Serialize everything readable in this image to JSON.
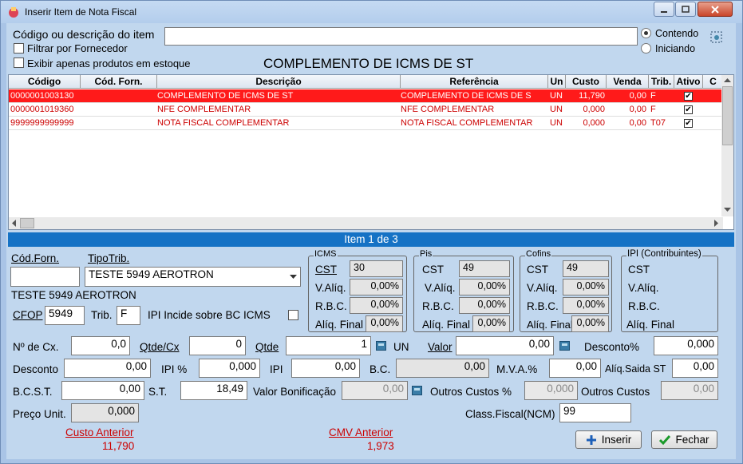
{
  "window": {
    "title": "Inserir Item de Nota Fiscal"
  },
  "search": {
    "label": "Código ou descrição do item",
    "value": "",
    "filter_supplier": "Filtrar por Fornecedor",
    "stock_only": "Exibir apenas produtos em estoque",
    "contendo": "Contendo",
    "iniciando": "Iniciando"
  },
  "selected_title": "COMPLEMENTO DE ICMS DE ST",
  "grid": {
    "headers": [
      "Código",
      "Cód. Forn.",
      "Descrição",
      "Referência",
      "Un",
      "Custo",
      "Venda",
      "Trib.",
      "Ativo",
      "C"
    ],
    "rows": [
      {
        "codigo": "0000001003130",
        "forn": "",
        "descricao": "COMPLEMENTO DE ICMS DE ST",
        "referencia": "COMPLEMENTO DE ICMS DE S",
        "un": "UN",
        "custo": "11,790",
        "venda": "0,00",
        "trib": "F",
        "ativo": "✔"
      },
      {
        "codigo": "0000001019360",
        "forn": "",
        "descricao": "NFE COMPLEMENTAR",
        "referencia": "NFE COMPLEMENTAR",
        "un": "UN",
        "custo": "0,000",
        "venda": "0,00",
        "trib": "F",
        "ativo": "✔"
      },
      {
        "codigo": "9999999999999",
        "forn": "",
        "descricao": "NOTA FISCAL COMPLEMENTAR",
        "referencia": "NOTA FISCAL COMPLEMENTAR",
        "un": "UN",
        "custo": "0,000",
        "venda": "0,00",
        "trib": "T07",
        "ativo": "✔"
      }
    ]
  },
  "item_bar": "Item 1 de 3",
  "form": {
    "cod_forn_label": "Cód.Forn.",
    "cod_forn_value": "",
    "tipotrib_label": "TipoTrib.",
    "tipotrib_value": "TESTE 5949 AEROTRON",
    "tipotrib_desc": "TESTE 5949 AEROTRON",
    "cfop_label": "CFOP",
    "cfop_value": "5949",
    "trib_label": "Trib.",
    "trib_value": "F",
    "ipi_incide_label": "IPI Incide sobre BC ICMS",
    "icms": {
      "title": "ICMS",
      "cst_label": "CST",
      "cst": "30",
      "valiq_label": "V.Alíq.",
      "valiq": "0,00%",
      "rbc_label": "R.B.C.",
      "rbc": "0,00%",
      "aliqfinal_label": "Alíq. Final",
      "aliqfinal": "0,00%"
    },
    "pis": {
      "title": "Pis",
      "cst_label": "CST",
      "cst": "49",
      "valiq_label": "V.Alíq.",
      "valiq": "0,00%",
      "rbc_label": "R.B.C.",
      "rbc": "0,00%",
      "aliqfinal_label": "Alíq. Final",
      "aliqfinal": "0,00%"
    },
    "cofins": {
      "title": "Cofins",
      "cst_label": "CST",
      "cst": "49",
      "valiq_label": "V.Alíq.",
      "valiq": "0,00%",
      "rbc_label": "R.B.C.",
      "rbc": "0,00%",
      "aliqfinal_label": "Alíq. Final",
      "aliqfinal": "0,00%"
    },
    "ipi": {
      "title": "IPI (Contribuintes)",
      "cst_label": "CST",
      "valiq_label": "V.Alíq.",
      "rbc_label": "R.B.C.",
      "aliqfinal_label": "Alíq. Final"
    },
    "ncx_label": "Nº de Cx.",
    "ncx": "0,0",
    "qtdecx_label": "Qtde/Cx",
    "qtdecx": "0",
    "qtde_label": "Qtde",
    "qtde": "1",
    "un": "UN",
    "valor_label": "Valor",
    "valor": "0,00",
    "descpct_label": "Desconto%",
    "descpct": "0,000",
    "desconto_label": "Desconto",
    "desconto": "0,00",
    "ipipct_label": "IPI %",
    "ipipct": "0,000",
    "ipi_label": "IPI",
    "ipi_val": "0,00",
    "bc_label": "B.C.",
    "bc": "0,00",
    "mva_label": "M.V.A.%",
    "mva": "0,00",
    "aliqst_label": "Alíq.Saida ST",
    "aliqst": "0,00",
    "bcst_label": "B.C.S.T.",
    "bcst": "0,00",
    "st_label": "S.T.",
    "st": "18,49",
    "bonif_label": "Valor Bonificação",
    "bonif": "0,00",
    "outpct_label": "Outros Custos %",
    "outpct": "0,000",
    "outros_label": "Outros Custos",
    "outros": "0,00",
    "preco_label": "Preço Unit.",
    "preco": "0,000",
    "ncm_label": "Class.Fiscal(NCM)",
    "ncm": "99",
    "custo_ant_label": "Custo Anterior",
    "custo_ant": "11,790",
    "cmv_ant_label": "CMV Anterior",
    "cmv_ant": "1,973"
  },
  "buttons": {
    "inserir": "Inserir",
    "fechar": "Fechar"
  }
}
